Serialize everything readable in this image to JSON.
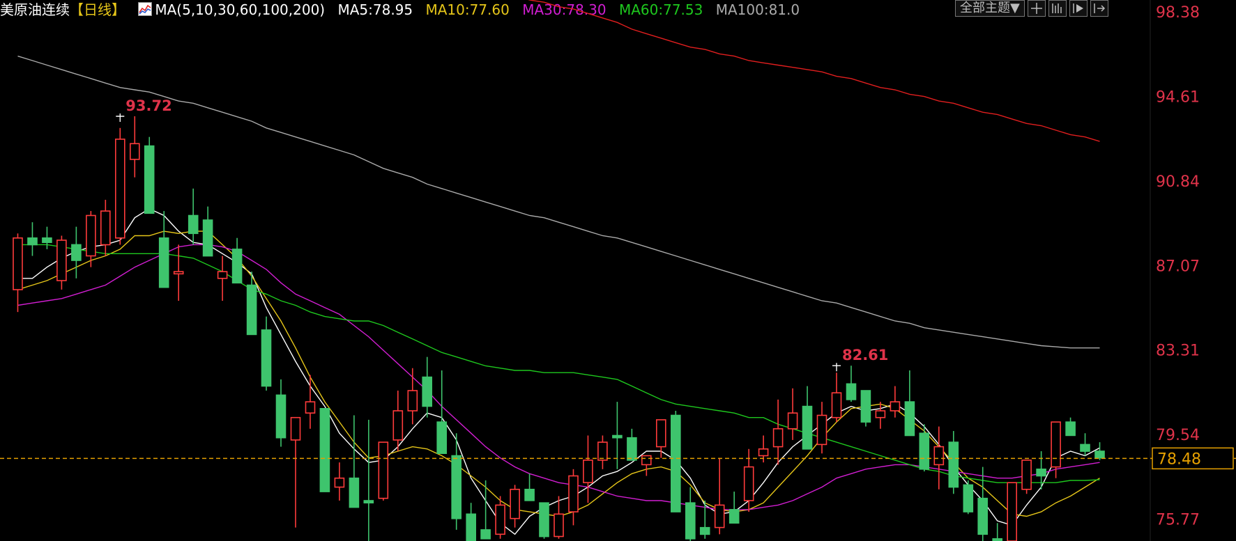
{
  "header": {
    "instrument": "美原油连续",
    "period": "【日线】",
    "ma_params": "MA(5,10,30,60,100,200)",
    "ma5": "MA5:78.95",
    "ma10": "MA10:77.60",
    "ma30": "MA30:78.30",
    "ma60": "MA60:77.53",
    "ma100": "MA100:81.0"
  },
  "toolbar": {
    "theme_label": "全部主题▼"
  },
  "colors": {
    "up": "#ff3b3b",
    "down": "#3ec46d",
    "ma5": "#ffffff",
    "ma10": "#e6c619",
    "ma30": "#d21ed2",
    "ma60": "#1ec81e",
    "ma100": "#aaaaaa",
    "ma200": "#e11e1e",
    "axis_text": "#e0334a",
    "current": "#e6a000"
  },
  "chart_data": {
    "type": "candlestick",
    "ylim": [
      74.8,
      98.9
    ],
    "y_ticks": [
      "98.38",
      "94.61",
      "90.84",
      "87.07",
      "83.31",
      "79.54",
      "75.77"
    ],
    "current_price": "78.48",
    "annotations": [
      {
        "label": "93.72",
        "index": 7,
        "value": 93.72
      },
      {
        "label": "82.61",
        "index": 56,
        "value": 82.61
      }
    ],
    "candles": [
      [
        86.0,
        88.5,
        85.0,
        88.3
      ],
      [
        88.3,
        89.0,
        87.5,
        88.0
      ],
      [
        88.3,
        88.8,
        87.8,
        88.1
      ],
      [
        86.4,
        88.4,
        86.0,
        88.2
      ],
      [
        88.0,
        88.8,
        86.5,
        87.3
      ],
      [
        87.5,
        89.5,
        87.0,
        89.3
      ],
      [
        88.0,
        90.0,
        87.5,
        89.5
      ],
      [
        88.3,
        93.2,
        88.0,
        92.7
      ],
      [
        91.8,
        93.72,
        91.0,
        92.5
      ],
      [
        92.4,
        92.8,
        89.8,
        89.4
      ],
      [
        88.3,
        89.5,
        86.5,
        86.1
      ],
      [
        86.7,
        88.0,
        85.5,
        86.8
      ],
      [
        89.3,
        90.5,
        88.0,
        88.5
      ],
      [
        89.1,
        89.7,
        88.0,
        87.5
      ],
      [
        86.5,
        87.5,
        85.5,
        86.8
      ],
      [
        87.8,
        88.3,
        86.5,
        86.3
      ],
      [
        86.2,
        86.8,
        84.5,
        84.0
      ],
      [
        84.2,
        84.8,
        81.5,
        81.7
      ],
      [
        81.3,
        82.0,
        79.0,
        79.4
      ],
      [
        79.3,
        80.3,
        75.4,
        80.3
      ],
      [
        80.5,
        82.2,
        79.8,
        81.0
      ],
      [
        80.7,
        80.7,
        77.3,
        77.0
      ],
      [
        77.2,
        78.3,
        76.6,
        77.6
      ],
      [
        77.6,
        80.4,
        76.3,
        76.3
      ],
      [
        76.6,
        80.2,
        74.5,
        76.5
      ],
      [
        76.7,
        79.2,
        76.6,
        79.2
      ],
      [
        79.3,
        81.5,
        78.8,
        80.6
      ],
      [
        80.6,
        82.5,
        80.0,
        81.5
      ],
      [
        82.1,
        83.0,
        80.3,
        80.8
      ],
      [
        80.1,
        82.4,
        79.0,
        78.7
      ],
      [
        78.6,
        79.6,
        75.3,
        75.8
      ],
      [
        76.0,
        76.5,
        74.7,
        74.6
      ],
      [
        75.3,
        77.5,
        74.9,
        74.9
      ],
      [
        75.1,
        76.8,
        74.9,
        76.4
      ],
      [
        75.8,
        77.3,
        75.4,
        77.1
      ],
      [
        77.1,
        77.8,
        76.9,
        76.6
      ],
      [
        76.5,
        76.5,
        74.9,
        75.0
      ],
      [
        75.0,
        76.8,
        74.9,
        76.0
      ],
      [
        76.1,
        78.0,
        75.5,
        77.7
      ],
      [
        77.4,
        79.5,
        76.5,
        78.4
      ],
      [
        78.4,
        79.5,
        78.0,
        79.2
      ],
      [
        79.5,
        81.0,
        78.0,
        79.4
      ],
      [
        79.4,
        79.8,
        78.4,
        78.4
      ],
      [
        78.2,
        78.5,
        77.7,
        78.6
      ],
      [
        79.0,
        79.9,
        78.5,
        80.2
      ],
      [
        80.4,
        80.6,
        76.3,
        76.1
      ],
      [
        76.5,
        77.2,
        74.7,
        74.9
      ],
      [
        75.4,
        76.6,
        74.9,
        75.1
      ],
      [
        75.4,
        78.5,
        75.1,
        76.4
      ],
      [
        76.2,
        77.0,
        75.9,
        75.6
      ],
      [
        76.6,
        78.9,
        76.1,
        78.1
      ],
      [
        78.6,
        79.5,
        78.3,
        78.9
      ],
      [
        79.0,
        81.1,
        78.2,
        79.8
      ],
      [
        79.8,
        81.6,
        79.3,
        80.5
      ],
      [
        80.8,
        81.7,
        79.3,
        78.9
      ],
      [
        79.1,
        81.0,
        78.7,
        80.4
      ],
      [
        80.3,
        82.3,
        80.1,
        81.4
      ],
      [
        81.8,
        82.61,
        81.0,
        81.1
      ],
      [
        81.5,
        81.4,
        79.9,
        80.1
      ],
      [
        80.3,
        81.0,
        79.8,
        80.6
      ],
      [
        80.6,
        81.7,
        80.3,
        81.0
      ],
      [
        81.0,
        82.4,
        79.5,
        79.5
      ],
      [
        79.6,
        80.0,
        77.9,
        78.0
      ],
      [
        78.2,
        79.9,
        77.1,
        79.0
      ],
      [
        79.2,
        79.7,
        76.9,
        77.2
      ],
      [
        77.3,
        77.5,
        76.0,
        76.1
      ],
      [
        76.7,
        78.1,
        74.8,
        75.1
      ],
      [
        74.9,
        75.6,
        74.7,
        74.7
      ],
      [
        74.8,
        76.2,
        74.7,
        77.4
      ],
      [
        77.1,
        78.4,
        76.9,
        78.4
      ],
      [
        78.0,
        78.8,
        77.1,
        77.7
      ],
      [
        78.1,
        80.0,
        77.6,
        80.1
      ],
      [
        80.1,
        80.3,
        79.5,
        79.5
      ],
      [
        79.1,
        79.6,
        78.6,
        78.8
      ],
      [
        78.8,
        79.2,
        78.4,
        78.5
      ]
    ],
    "series": [
      {
        "name": "MA5",
        "values": [
          86.5,
          86.5,
          87.0,
          87.4,
          87.7,
          87.9,
          88.0,
          88.2,
          89.2,
          89.6,
          89.3,
          88.6,
          88.1,
          88.0,
          87.6,
          87.2,
          86.7,
          85.2,
          84.0,
          82.8,
          81.7,
          80.8,
          79.6,
          78.9,
          78.3,
          78.4,
          79.0,
          79.8,
          80.5,
          80.3,
          79.3,
          77.6,
          76.6,
          75.6,
          75.1,
          75.9,
          76.3,
          76.6,
          76.8,
          77.2,
          77.7,
          77.9,
          78.3,
          78.8,
          78.8,
          78.4,
          77.6,
          76.4,
          76.0,
          76.1,
          76.6,
          77.4,
          78.3,
          79.0,
          79.5,
          80.0,
          80.5,
          80.8,
          80.6,
          80.7,
          80.9,
          80.5,
          79.9,
          79.1,
          78.1,
          77.3,
          76.6,
          75.7,
          75.5,
          76.4,
          77.2,
          78.5,
          78.8,
          78.6,
          78.95
        ]
      },
      {
        "name": "MA10",
        "values": [
          86.0,
          86.2,
          86.4,
          86.7,
          87.0,
          87.3,
          87.5,
          87.8,
          88.4,
          88.4,
          88.6,
          88.5,
          88.6,
          88.6,
          88.0,
          87.4,
          86.6,
          85.6,
          84.6,
          83.4,
          82.1,
          81.0,
          80.1,
          79.2,
          78.5,
          78.6,
          78.8,
          79.0,
          78.9,
          78.6,
          78.2,
          77.7,
          77.2,
          76.6,
          76.2,
          76.1,
          76.0,
          75.9,
          76.1,
          76.4,
          76.9,
          77.4,
          77.8,
          78.0,
          78.1,
          77.9,
          77.3,
          76.5,
          76.2,
          76.1,
          76.2,
          76.5,
          77.2,
          77.9,
          78.6,
          79.4,
          80.1,
          80.7,
          80.8,
          80.9,
          80.7,
          80.2,
          79.7,
          79.0,
          78.3,
          77.6,
          77.2,
          76.6,
          76.0,
          75.9,
          76.1,
          76.5,
          76.8,
          77.2,
          77.6
        ]
      },
      {
        "name": "MA30",
        "values": [
          85.3,
          85.4,
          85.5,
          85.6,
          85.8,
          86.0,
          86.2,
          86.6,
          87.0,
          87.3,
          87.6,
          87.9,
          88.0,
          88.0,
          87.9,
          87.7,
          87.3,
          86.9,
          86.3,
          85.8,
          85.5,
          85.2,
          84.9,
          84.4,
          83.9,
          83.3,
          82.7,
          82.1,
          81.5,
          80.8,
          80.2,
          79.6,
          79.0,
          78.5,
          78.1,
          77.8,
          77.6,
          77.4,
          77.3,
          77.2,
          77.0,
          76.8,
          76.7,
          76.6,
          76.6,
          76.5,
          76.4,
          76.3,
          76.2,
          76.2,
          76.2,
          76.3,
          76.4,
          76.6,
          76.9,
          77.2,
          77.6,
          77.8,
          78.0,
          78.1,
          78.2,
          78.2,
          78.1,
          78.0,
          77.9,
          77.8,
          77.7,
          77.6,
          77.6,
          77.7,
          77.8,
          78.0,
          78.1,
          78.2,
          78.3
        ]
      },
      {
        "name": "MA60",
        "values": [
          88.0,
          88.0,
          88.0,
          87.9,
          87.8,
          87.7,
          87.6,
          87.6,
          87.6,
          87.6,
          87.6,
          87.5,
          87.4,
          87.1,
          86.8,
          86.4,
          86.0,
          85.8,
          85.5,
          85.3,
          85.0,
          84.8,
          84.7,
          84.6,
          84.6,
          84.4,
          84.1,
          83.8,
          83.5,
          83.2,
          83.0,
          82.8,
          82.6,
          82.5,
          82.4,
          82.4,
          82.3,
          82.3,
          82.3,
          82.2,
          82.1,
          82.0,
          81.7,
          81.4,
          81.1,
          80.9,
          80.8,
          80.7,
          80.6,
          80.5,
          80.3,
          80.3,
          80.0,
          79.8,
          79.6,
          79.4,
          79.2,
          79.0,
          78.8,
          78.6,
          78.4,
          78.2,
          78.0,
          77.9,
          77.7,
          77.6,
          77.5,
          77.4,
          77.4,
          77.4,
          77.4,
          77.4,
          77.5,
          77.5,
          77.53
        ]
      },
      {
        "name": "MA100",
        "values": [
          96.4,
          96.2,
          96.0,
          95.8,
          95.6,
          95.4,
          95.2,
          95.0,
          94.9,
          94.8,
          94.6,
          94.4,
          94.3,
          94.1,
          93.9,
          93.7,
          93.5,
          93.2,
          93.0,
          92.8,
          92.6,
          92.4,
          92.2,
          92.0,
          91.7,
          91.4,
          91.2,
          91.0,
          90.7,
          90.5,
          90.3,
          90.1,
          89.9,
          89.7,
          89.5,
          89.3,
          89.2,
          89.0,
          88.8,
          88.6,
          88.4,
          88.3,
          88.1,
          87.9,
          87.7,
          87.5,
          87.3,
          87.1,
          86.9,
          86.7,
          86.5,
          86.3,
          86.1,
          85.9,
          85.7,
          85.5,
          85.4,
          85.2,
          85.0,
          84.8,
          84.6,
          84.5,
          84.3,
          84.2,
          84.1,
          84.0,
          83.9,
          83.8,
          83.7,
          83.6,
          83.5,
          83.45,
          83.4,
          83.4,
          83.4
        ]
      },
      {
        "name": "MA200",
        "values": [
          101.7,
          101.7,
          101.8,
          101.8,
          101.8,
          101.8,
          101.8,
          101.8,
          101.8,
          101.8,
          101.8,
          101.7,
          101.7,
          101.7,
          101.6,
          101.6,
          101.5,
          101.5,
          101.4,
          101.3,
          101.2,
          101.2,
          101.1,
          101.0,
          100.9,
          100.8,
          100.6,
          100.4,
          100.2,
          100.0,
          99.8,
          99.6,
          99.4,
          99.2,
          99.1,
          98.9,
          98.8,
          98.6,
          98.5,
          98.3,
          98.1,
          97.9,
          97.6,
          97.4,
          97.2,
          97.0,
          96.8,
          96.7,
          96.5,
          96.4,
          96.2,
          96.1,
          96.0,
          95.9,
          95.8,
          95.7,
          95.5,
          95.4,
          95.2,
          95.0,
          94.9,
          94.7,
          94.6,
          94.4,
          94.3,
          94.1,
          93.9,
          93.8,
          93.6,
          93.4,
          93.3,
          93.1,
          92.9,
          92.8,
          92.6
        ]
      }
    ]
  }
}
